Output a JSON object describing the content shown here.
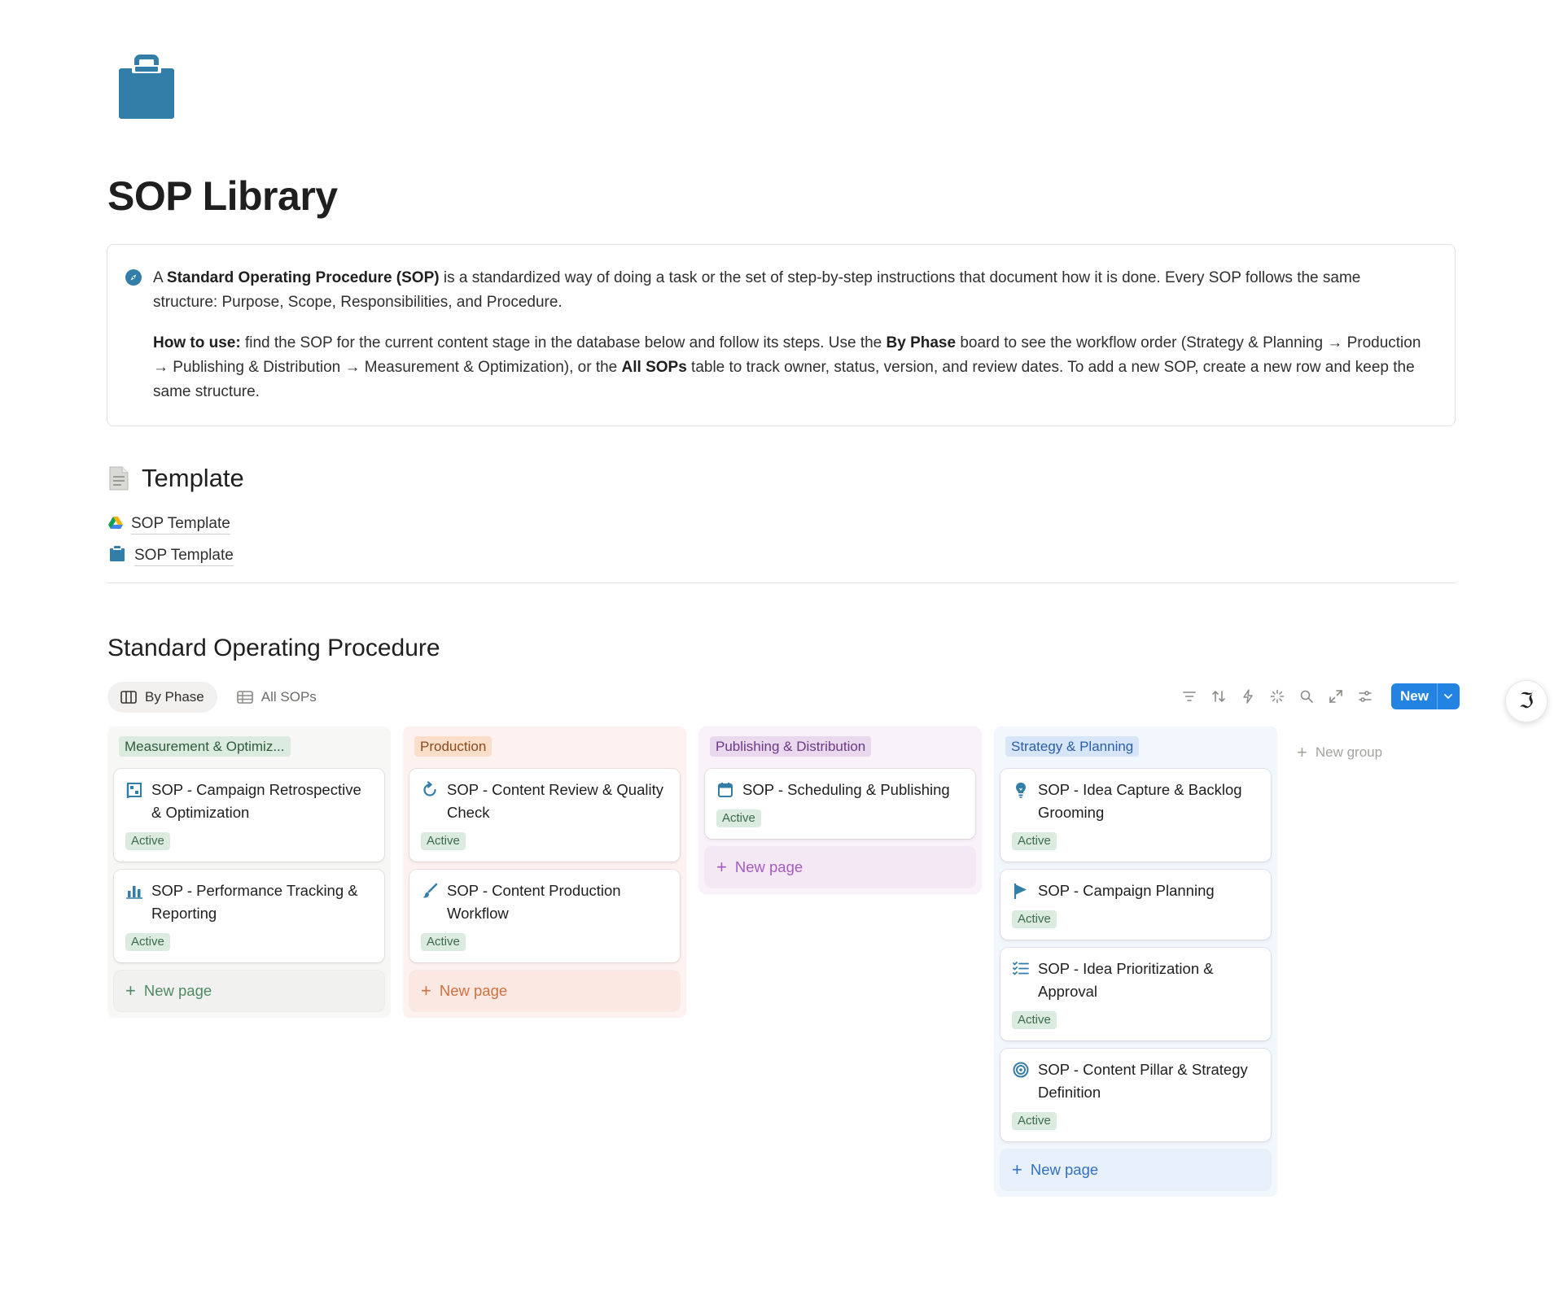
{
  "page": {
    "icon": "clipboard-icon",
    "title": "SOP Library"
  },
  "callout": {
    "icon": "compass-icon",
    "p1": {
      "t1": "A ",
      "b1": "Standard Operating Procedure (SOP)",
      "t2": " is a standardized way of doing a task or the set of step-by-step instructions that document how it is done. Every SOP follows the same structure: Purpose, Scope, Responsibilities, and Procedure."
    },
    "p2": {
      "b1": "How to use:",
      "t1": " find the SOP for the current content stage in the database below and follow its steps. Use the ",
      "b2": "By Phase",
      "t2": " board to see the workflow order (Strategy & Planning → Production → Publishing & Distribution → Measurement & Optimization), or the ",
      "b3": "All SOPs",
      "t3": " table to track owner, status, version, and review dates. To add a new SOP, create a new row and keep the same structure."
    }
  },
  "template_section": {
    "heading": "Template",
    "icon": "document-icon",
    "links": [
      {
        "label": "SOP Template",
        "icon": "google-drive-icon"
      },
      {
        "label": "SOP Template",
        "icon": "clipboard-icon"
      }
    ]
  },
  "database": {
    "title": "Standard Operating Procedure",
    "views": [
      {
        "label": "By Phase",
        "icon": "board-icon",
        "active": true
      },
      {
        "label": "All SOPs",
        "icon": "table-icon",
        "active": false
      }
    ],
    "toolbar": {
      "icons": [
        "filter-icon",
        "sort-icon",
        "automation-icon",
        "ai-sparkle-icon",
        "search-icon",
        "expand-icon",
        "settings-icon"
      ],
      "new_label": "New"
    },
    "columns": [
      {
        "name": "Measurement & Optimiz...",
        "cards": [
          {
            "title": "SOP - Campaign Retrospective & Optimization",
            "icon": "analysis-board-icon",
            "status": "Active"
          },
          {
            "title": "SOP - Performance Tracking & Reporting",
            "icon": "bar-chart-icon",
            "status": "Active"
          }
        ],
        "new_page": "New page"
      },
      {
        "name": "Production",
        "cards": [
          {
            "title": "SOP - Content Review & Quality Check",
            "icon": "refresh-icon",
            "status": "Active"
          },
          {
            "title": "SOP - Content Production Workflow",
            "icon": "paintbrush-icon",
            "status": "Active"
          }
        ],
        "new_page": "New page"
      },
      {
        "name": "Publishing & Distribution",
        "cards": [
          {
            "title": "SOP - Scheduling & Publishing",
            "icon": "calendar-icon",
            "status": "Active"
          }
        ],
        "new_page": "New page"
      },
      {
        "name": "Strategy & Planning",
        "cards": [
          {
            "title": "SOP - Idea Capture & Backlog Grooming",
            "icon": "lightbulb-icon",
            "status": "Active"
          },
          {
            "title": "SOP - Campaign Planning",
            "icon": "flag-icon",
            "status": "Active"
          },
          {
            "title": "SOP - Idea Prioritization & Approval",
            "icon": "checklist-icon",
            "status": "Active"
          },
          {
            "title": "SOP - Content Pillar & Strategy Definition",
            "icon": "target-icon",
            "status": "Active"
          }
        ],
        "new_page": "New page"
      }
    ],
    "new_group": "New group"
  },
  "colors": {
    "accent_blue": "#2383e2",
    "icon_blue": "#337ea9",
    "status_green_bg": "#dcebe0"
  }
}
